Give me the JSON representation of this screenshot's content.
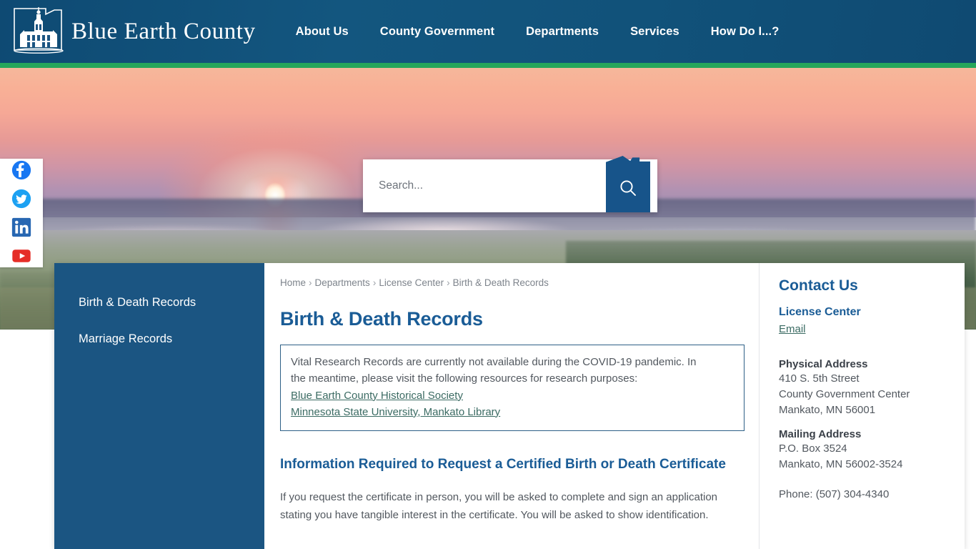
{
  "site": {
    "logo_text": "Blue Earth County",
    "logo_icon": "county-courthouse-logo",
    "brand_blue": "#11527a",
    "accent_green": "#26a65b",
    "heading_blue": "#1a5c96",
    "link_teal": "#3b6b63",
    "sidebar_blue": "#1b5582"
  },
  "nav": {
    "items": [
      {
        "label": "About Us"
      },
      {
        "label": "County Government"
      },
      {
        "label": "Departments"
      },
      {
        "label": "Services"
      },
      {
        "label": "How Do I...?"
      }
    ]
  },
  "social": {
    "items": [
      {
        "name": "facebook-icon",
        "label": "Facebook",
        "color": "#1877F2"
      },
      {
        "name": "twitter-icon",
        "label": "Twitter",
        "color": "#1DA1F2"
      },
      {
        "name": "linkedin-icon",
        "label": "LinkedIn",
        "color": "#2867B2"
      },
      {
        "name": "youtube-icon",
        "label": "YouTube",
        "color": "#E52D27"
      }
    ]
  },
  "search": {
    "placeholder": "Search...",
    "value": "",
    "button_icon": "search-icon",
    "button_shape": "minnesota-state-outline"
  },
  "sidebar": {
    "items": [
      {
        "label": "Birth & Death Records",
        "active": true
      },
      {
        "label": "Marriage Records",
        "active": false
      }
    ]
  },
  "breadcrumb": {
    "separator": "›",
    "items": [
      {
        "label": "Home"
      },
      {
        "label": "Departments"
      },
      {
        "label": "License Center"
      },
      {
        "label": "Birth & Death Records"
      }
    ]
  },
  "main": {
    "page_title": "Birth & Death Records",
    "alert": {
      "line1": "Vital Research Records are currently not available during the COVID-19 pandemic.  In",
      "line2": "the meantime, please visit the following resources for research purposes:",
      "links": [
        {
          "label": "Blue Earth County Historical Society"
        },
        {
          "label": "Minnesota State University, Mankato Library"
        }
      ]
    },
    "section_title": "Information Required to Request a Certified Birth or Death Certificate",
    "body_paragraph": "If you request the certificate in person, you will be asked to complete and sign an application stating you have tangible interest in the certificate. You will be asked to show identification."
  },
  "contact": {
    "heading": "Contact Us",
    "department": "License Center",
    "email_label": "Email",
    "physical_address_label": "Physical Address",
    "physical_address_lines": [
      "410 S. 5th Street",
      "County Government Center",
      "Mankato, MN 56001"
    ],
    "mailing_address_label": "Mailing Address",
    "mailing_address_lines": [
      "P.O. Box 3524",
      "Mankato, MN 56002-3524"
    ],
    "phone": "Phone: (507) 304-4340"
  }
}
